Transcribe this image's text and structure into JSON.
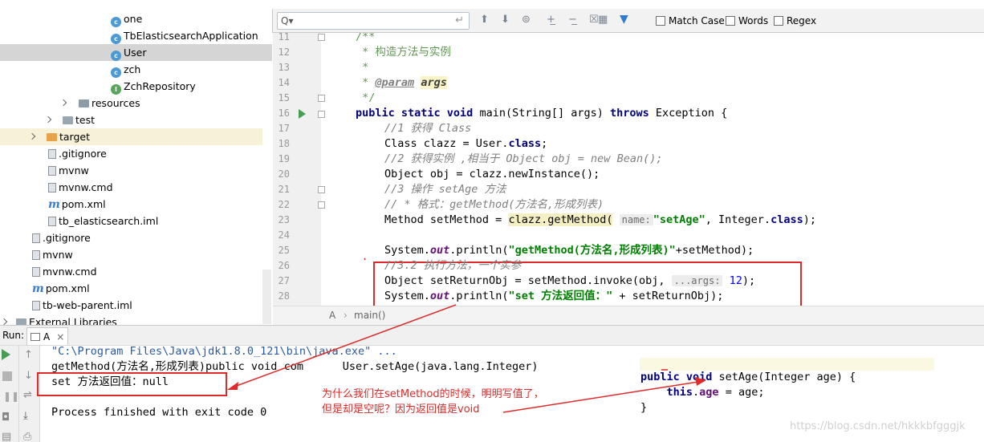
{
  "tree": {
    "items": [
      {
        "label": "one",
        "icon": "class-icon"
      },
      {
        "label": "TbElasticsearchApplication",
        "icon": "class-icon"
      },
      {
        "label": "User",
        "icon": "class-icon"
      },
      {
        "label": "zch",
        "icon": "class-icon"
      },
      {
        "label": "ZchRepository",
        "icon": "interface-icon"
      },
      {
        "label": "resources",
        "icon": "folder-icon"
      },
      {
        "label": "test",
        "icon": "folder-icon"
      },
      {
        "label": "target",
        "icon": "folder-icon"
      },
      {
        "label": ".gitignore",
        "icon": "file-icon"
      },
      {
        "label": "mvnw",
        "icon": "file-icon"
      },
      {
        "label": "mvnw.cmd",
        "icon": "file-icon"
      },
      {
        "label": "pom.xml",
        "icon": "maven-icon"
      },
      {
        "label": "tb_elasticsearch.iml",
        "icon": "file-icon"
      },
      {
        "label": ".gitignore",
        "icon": "file-icon"
      },
      {
        "label": "mvnw",
        "icon": "file-icon"
      },
      {
        "label": "mvnw.cmd",
        "icon": "file-icon"
      },
      {
        "label": "pom.xml",
        "icon": "maven-icon"
      },
      {
        "label": "tb-web-parent.iml",
        "icon": "file-icon"
      },
      {
        "label": "External Libraries",
        "icon": "library-icon"
      }
    ],
    "class_badge": "c",
    "interface_badge": "I",
    "maven_badge": "m"
  },
  "find": {
    "search_icon": "Q▾",
    "enter_icon": "↵",
    "match_case": "Match Case",
    "words": "Words",
    "regex": "Regex"
  },
  "editor": {
    "line_numbers": [
      "11",
      "12",
      "13",
      "14",
      "15",
      "16",
      "17",
      "18",
      "19",
      "20",
      "21",
      "22",
      "23",
      "24",
      "25",
      "26",
      "27",
      "28"
    ],
    "breadcrumb": [
      "A",
      "main()"
    ],
    "code": {
      "l11": "/**",
      "l12": " * 构造方法与实例",
      "l13": " *",
      "l14_tag": "@param",
      "l14_arg": "args",
      "l15": " */",
      "l16_kw1": "public static void",
      "l16_a": " main(String[] args) ",
      "l16_kw2": "throws",
      "l16_b": " Exception {",
      "l17": "//1 获得 Class",
      "l18_a": "Class clazz = User.",
      "l18_kw": "class",
      "l18_b": ";",
      "l19": "//2 获得实例 ,相当于 Object obj = new Bean();",
      "l20": "Object obj = clazz.newInstance();",
      "l21": "//3 操作 setAge 方法",
      "l22": "// * 格式：getMethod(方法名,形成列表)",
      "l23_a": "Method setMethod = ",
      "l23_hl": "clazz.getMethod(",
      "l23_hint": "name:",
      "l23_str": "\"setAge\"",
      "l23_b": ", Integer.",
      "l23_kw": "class",
      "l23_c": ");",
      "l25_a": "System.",
      "l25_fld": "out",
      "l25_b": ".println(",
      "l25_str": "\"getMethod(方法名,形成列表)\"",
      "l25_c": "+setMethod);",
      "l26": "//3.2 执行方法，一个实参",
      "l27_a": "Object setReturnObj = setMethod.invoke(obj, ",
      "l27_hint": "...args:",
      "l27_num": "12",
      "l27_b": ");",
      "l28_a": "System.",
      "l28_fld": "out",
      "l28_b": ".println(",
      "l28_str": "\"set 方法返回值：\"",
      "l28_c": " + setReturnObj);"
    }
  },
  "run": {
    "title": "Run:",
    "tab_label": "A",
    "tab_close": "×",
    "console": [
      "\"C:\\Program Files\\Java\\jdk1.8.0_121\\bin\\java.exe\" ...",
      "getMethod(方法名,形成列表)public void com      User.setAge(java.lang.Integer)",
      "set 方法返回值：null",
      "",
      "Process finished with exit code 0"
    ]
  },
  "snippet": {
    "l1_kw": "public void",
    "l1_rest": " setAge(Integer age) {",
    "l2_kw": "this",
    "l2_dot": ".",
    "l2_fld": "age",
    "l2_rest": " = age;",
    "l3": "}"
  },
  "annotations": {
    "note_line1": "为什么我们在setMethod的时候，明明写值了，",
    "note_line2": "但是却是空呢？因为返回值是void",
    "color": "#e02a2a"
  },
  "watermark": "https://blog.csdn.net/hkkkbfgggjk"
}
